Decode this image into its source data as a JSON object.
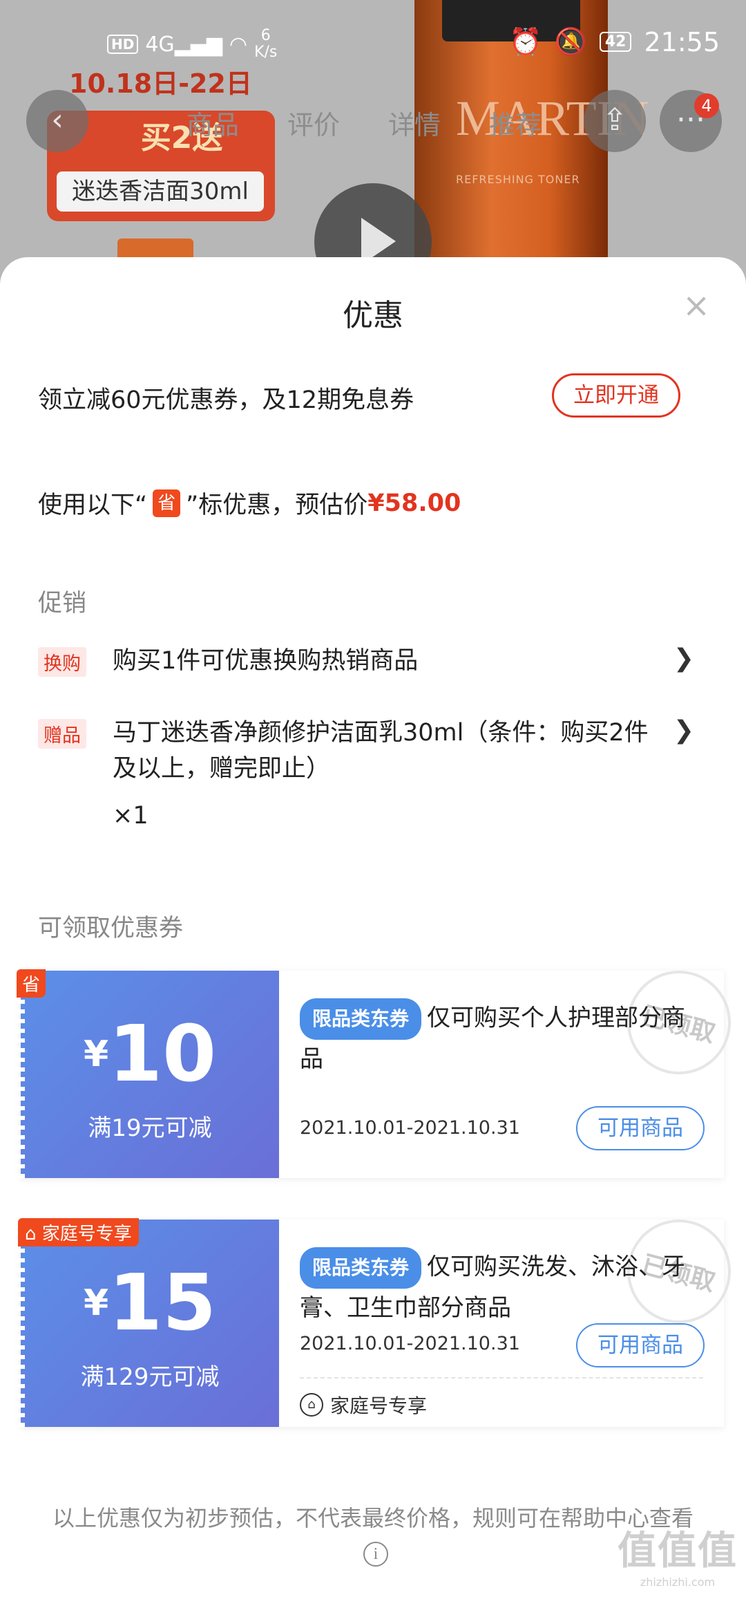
{
  "status_bar": {
    "hd": "HD",
    "network": "4G",
    "speed_value": "6",
    "speed_unit": "K/s",
    "battery": "42",
    "time": "21:55"
  },
  "background": {
    "date": "10.18日-22日",
    "promo_top": "买2送",
    "promo_bottom": "迷迭香洁面30ml",
    "brand": "MARTIN",
    "brand_sub": "REFRESHING TONER",
    "tabs": [
      "商品",
      "评价",
      "详情",
      "推荐"
    ],
    "cart_badge": "4"
  },
  "sheet": {
    "title": "优惠",
    "open_text": "领立减60元优惠券，及12期免息券",
    "open_button": "立即开通",
    "estimate_prefix": "使用以下“",
    "estimate_tag": "省",
    "estimate_suffix": "”标优惠，预估价",
    "estimate_price": "¥58.00",
    "promotions_label": "促销",
    "promotions": [
      {
        "tag": "换购",
        "text": "购买1件可优惠换购热销商品"
      },
      {
        "tag": "赠品",
        "text": "马丁迷迭香净颜修护洁面乳30ml（条件：购买2件及以上，赠完即止）",
        "qty": "×1"
      }
    ],
    "coupons_label": "可领取优惠券",
    "coupons": [
      {
        "corner": "省",
        "yen": "¥",
        "amount": "10",
        "condition": "满19元可减",
        "category": "限品类东券",
        "description": "仅可购买个人护理部分商品",
        "dates": "2021.10.01-2021.10.31",
        "button": "可用商品",
        "stamp": "已领取"
      },
      {
        "corner": "家庭号专享",
        "yen": "¥",
        "amount": "15",
        "condition": "满129元可减",
        "category": "限品类东券",
        "description": "仅可购买洗发、沐浴、牙膏、卫生巾部分商品",
        "dates": "2021.10.01-2021.10.31",
        "button": "可用商品",
        "stamp": "已领取",
        "family_note": "家庭号专享"
      }
    ],
    "disclaimer": "以上优惠仅为初步预估，不代表最终价格，规则可在帮助中心查看"
  },
  "watermark": {
    "big": "值值值",
    "small": "zhizhizhi.com"
  }
}
